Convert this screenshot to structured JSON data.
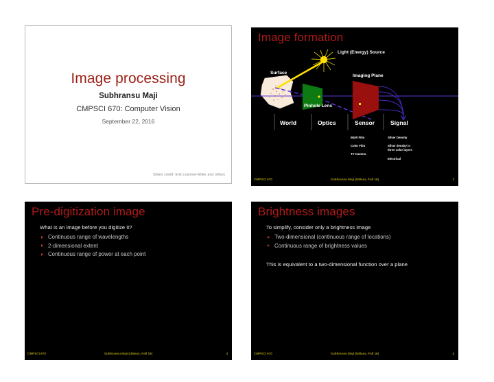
{
  "page": {
    "background": "#ffffff",
    "layout": "2x2 lecture slide thumbnails"
  },
  "colors": {
    "title_red": "#9d2117",
    "slide_title_red": "#b01b1b",
    "footer_yellow": "#a89a10",
    "bullet_marker": "#c0392b",
    "slide_background": "#000000",
    "lens_green": "#0e7a12",
    "imaging_plane_red": "#99100f",
    "light_yellow": "#ffe000",
    "ray_purple": "#5b33d4",
    "surface_cream": "#f7e8d8"
  },
  "slides": [
    {
      "number": "1",
      "kind": "title",
      "title": "Image processing",
      "author": "Subhransu Maji",
      "course": "CMPSCI 670: Computer Vision",
      "date": "September 22, 2016",
      "credit": "Slides credit: Erik Learned-Miller and others"
    },
    {
      "number": "2",
      "kind": "diagram",
      "title": "Image formation",
      "diagram_labels": {
        "light_source": "Light (Energy) Source",
        "surface": "Surface",
        "imaging_plane": "Imaging Plane",
        "pinhole_lens": "Pinhole Lens"
      },
      "stages": [
        "World",
        "Optics",
        "Sensor",
        "Signal"
      ],
      "table": {
        "rows": [
          {
            "sensor": "B&W Film",
            "signal": "Silver Density"
          },
          {
            "sensor": "Color Film",
            "signal": "Silver density in three color layers"
          },
          {
            "sensor": "TV Camera",
            "signal": "Electrical"
          }
        ]
      },
      "footer": {
        "left": "CMPSCI 670",
        "center": "Subhransu Maji (UMass, Fall 16)",
        "right": "2"
      }
    },
    {
      "number": "3",
      "kind": "bullets",
      "title": "Pre-digitization image",
      "lead": "What is an image before you digitize it?",
      "bullets": [
        "Continuous range of wavelengths",
        "2-dimensional extent",
        "Continuous range of power at each point"
      ],
      "closing": "",
      "footer": {
        "left": "CMPSCI 670",
        "center": "Subhransu Maji (UMass, Fall 16)",
        "right": "3"
      }
    },
    {
      "number": "4",
      "kind": "bullets",
      "title": "Brightness images",
      "lead": "To simplify, consider only a brightness image",
      "bullets": [
        "Two-dimensional (continuous range of locations)",
        "Continuous range of brightness values"
      ],
      "closing": "This is equivalent to a two-dimensional function over a plane",
      "footer": {
        "left": "CMPSCI 670",
        "center": "Subhransu Maji (UMass, Fall 16)",
        "right": "4"
      }
    }
  ]
}
